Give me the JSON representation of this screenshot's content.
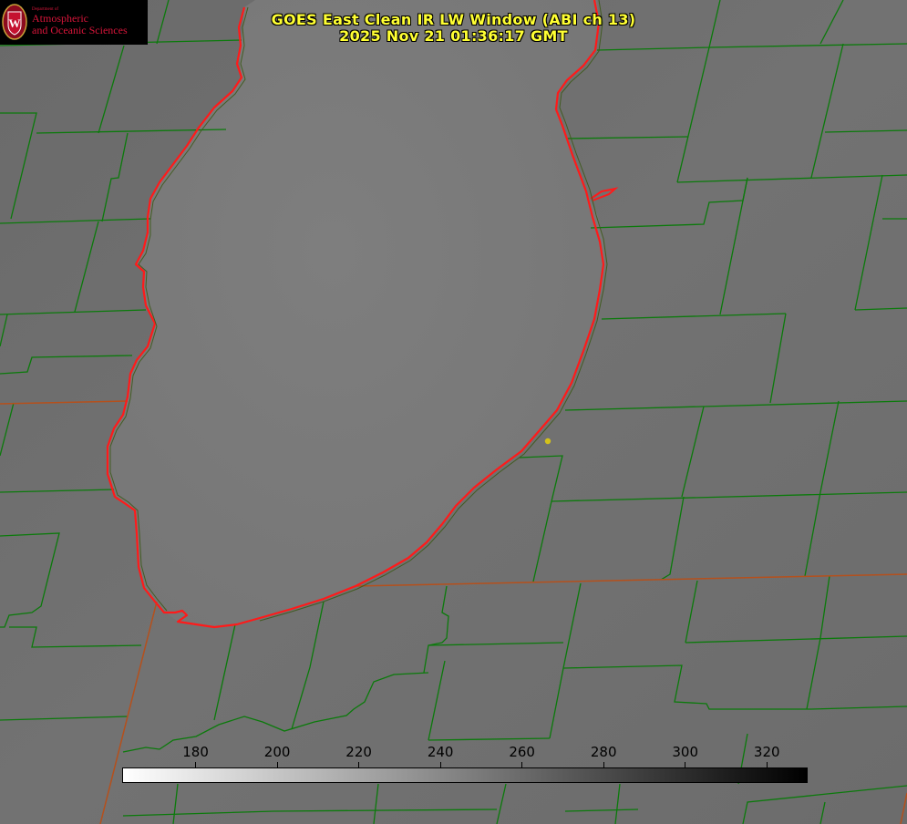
{
  "title": {
    "line1": "GOES East Clean IR LW Window (ABI ch 13)",
    "line2": "2025 Nov 21 01:36:17 GMT"
  },
  "logo": {
    "dept": "Department of",
    "name_line1": "Atmospheric",
    "name_line2": "and Oceanic Sciences",
    "seal_letter": "W"
  },
  "colorbar": {
    "min": 162,
    "max": 330,
    "ticks": [
      "180",
      "200",
      "220",
      "240",
      "260",
      "280",
      "300",
      "320"
    ],
    "color_low": "#ffffff",
    "color_high": "#000000"
  },
  "colors": {
    "background": "#6f6f6f",
    "lake": "#7a7a7a",
    "county_lines": "#0b7a0b",
    "state_lines": "#b5501c",
    "coastline": "#ff1a1a",
    "title_text": "#ffff33",
    "marker": "#d4c21a"
  }
}
